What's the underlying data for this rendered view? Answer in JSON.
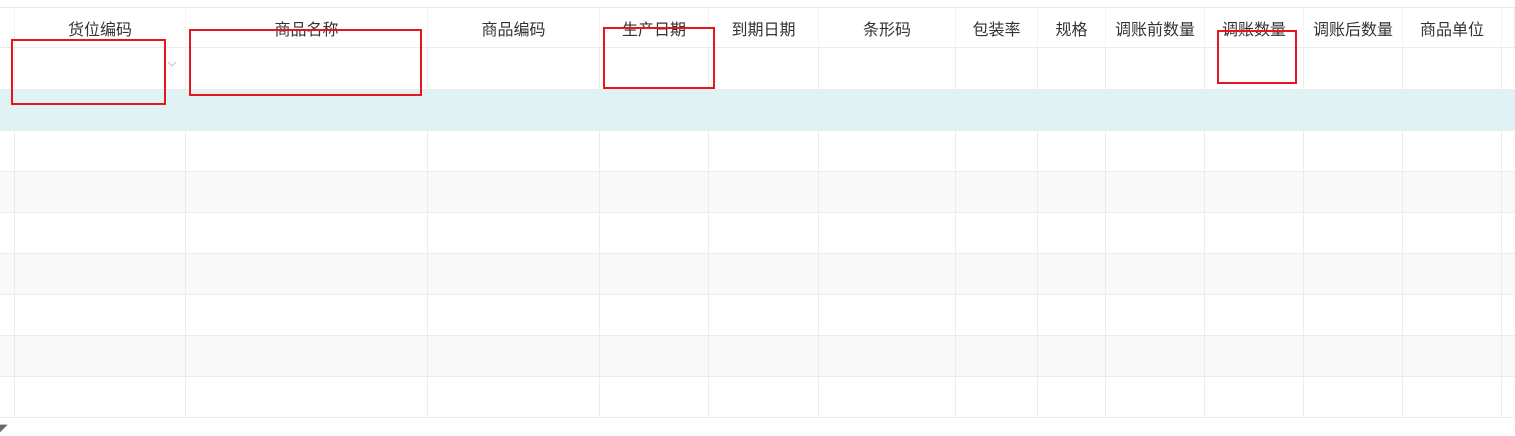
{
  "columns": [
    {
      "key": "location_code",
      "label": "货位编码"
    },
    {
      "key": "product_name",
      "label": "商品名称"
    },
    {
      "key": "product_code",
      "label": "商品编码"
    },
    {
      "key": "production_date",
      "label": "生产日期"
    },
    {
      "key": "expiry_date",
      "label": "到期日期"
    },
    {
      "key": "barcode",
      "label": "条形码"
    },
    {
      "key": "packing_rate",
      "label": "包装率"
    },
    {
      "key": "spec",
      "label": "规格"
    },
    {
      "key": "qty_before",
      "label": "调账前数量"
    },
    {
      "key": "adjust_qty",
      "label": "调账数量"
    },
    {
      "key": "qty_after",
      "label": "调账后数量"
    },
    {
      "key": "unit",
      "label": "商品单位"
    }
  ],
  "edit_row": {
    "location_code": "",
    "product_name": "",
    "product_code": "",
    "production_date": "",
    "expiry_date": "",
    "barcode": "",
    "packing_rate": "",
    "spec": "",
    "qty_before": "",
    "adjust_qty": "",
    "qty_after": "",
    "unit": ""
  },
  "annotations": {
    "color": "#e8141e",
    "highlighted_fields": [
      "location_code",
      "product_name",
      "production_date",
      "adjust_qty"
    ]
  },
  "colors": {
    "selected_row": "#e0f3f4",
    "stripe_row": "#f9f9f9",
    "grid_line": "#ececec"
  },
  "icons": {
    "dropdown": "chevron-down-icon"
  }
}
